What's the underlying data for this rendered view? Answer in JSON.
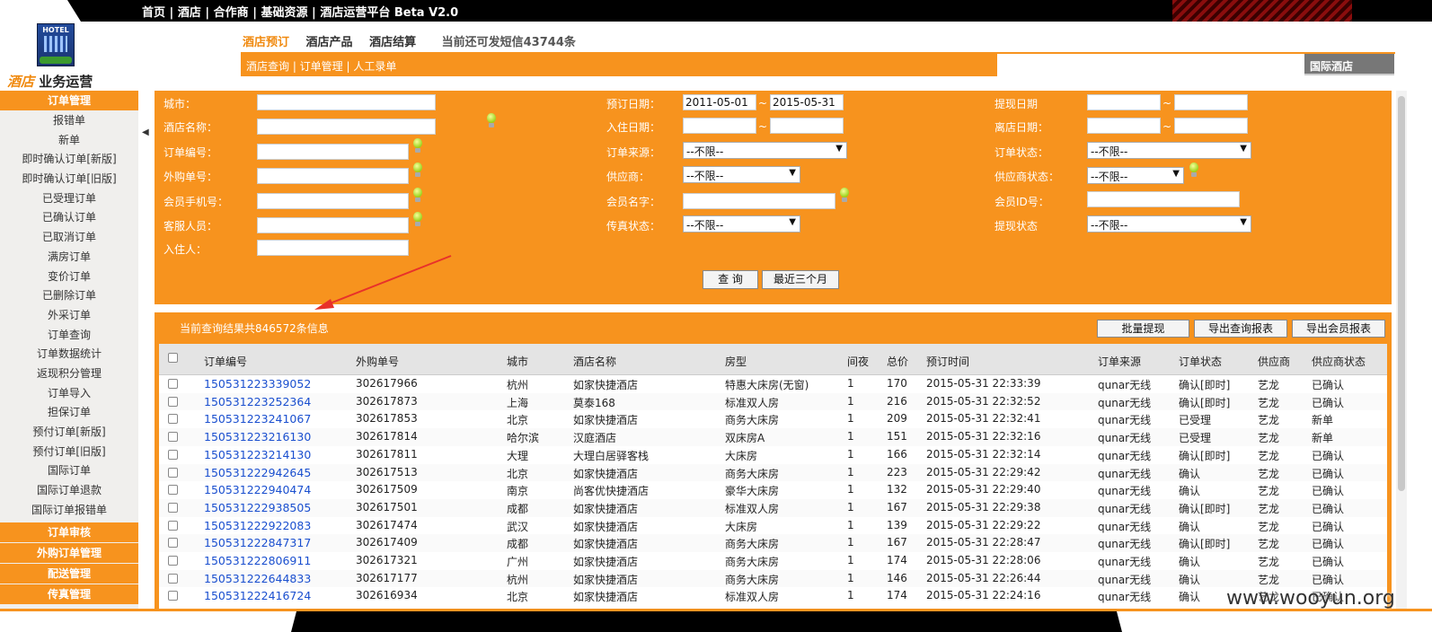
{
  "top_nav": [
    "首页",
    "酒店",
    "合作商",
    "基础资源",
    "酒店运营平台 Beta V2.0"
  ],
  "logo": {
    "badge": "HOTEL",
    "title_orange": "酒店",
    "title_black": "业务运营"
  },
  "sub_nav": {
    "tabs": [
      "酒店预订",
      "酒店产品",
      "酒店结算"
    ],
    "active": 0,
    "sms_text": "当前还可发短信43744条"
  },
  "breadcrumb": "酒店查询 | 订单管理 | 人工录单",
  "intl_tab": "国际酒店",
  "sidebar": {
    "section1": "订单管理",
    "items": [
      "报错单",
      "新单",
      "即时确认订单[新版]",
      "即时确认订单[旧版]",
      "已受理订单",
      "已确认订单",
      "已取消订单",
      "满房订单",
      "变价订单",
      "已删除订单",
      "外采订单",
      "订单查询",
      "订单数据统计",
      "返现积分管理",
      "订单导入",
      "担保订单",
      "预付订单[新版]",
      "预付订单[旧版]",
      "国际订单",
      "国际订单退款",
      "国际订单报错单"
    ],
    "bottom_sections": [
      "订单审核",
      "外购订单管理",
      "配送管理",
      "传真管理"
    ]
  },
  "search": {
    "labels": {
      "city": "城市：",
      "hotel_name": "酒店名称：",
      "order_no": "订单编号：",
      "ext_order_no": "外购单号：",
      "member_phone": "会员手机号：",
      "cs_staff": "客服人员：",
      "guest": "入住人：",
      "book_date": "预订日期：",
      "checkin_date": "入住日期：",
      "order_source": "订单来源：",
      "supplier": "供应商：",
      "member_name": "会员名字：",
      "fax_status": "传真状态：",
      "cashout_date": "提现日期",
      "checkout_date": "离店日期：",
      "order_status": "订单状态：",
      "supplier_status": "供应商状态：",
      "member_id": "会员ID号：",
      "cashout_status": "提现状态"
    },
    "book_date_from": "2011-05-01",
    "book_date_to": "2015-05-31",
    "tilde": "~",
    "select_default": "--不限--",
    "query_button": "查 询",
    "recent_button": "最近三个月"
  },
  "results": {
    "count_text": "当前查询结果共846572条信息",
    "buttons": [
      "批量提现",
      "导出查询报表",
      "导出会员报表"
    ],
    "headers": [
      "订单编号",
      "外购单号",
      "城市",
      "酒店名称",
      "房型",
      "间夜",
      "总价",
      "预订时间",
      "订单来源",
      "订单状态",
      "供应商",
      "供应商状态"
    ],
    "rows": [
      [
        "150531223339052",
        "302617966",
        "杭州",
        "如家快捷酒店",
        "特惠大床房(无窗)",
        "1",
        "170",
        "2015-05-31 22:33:39",
        "qunar无线",
        "确认[即时]",
        "艺龙",
        "已确认"
      ],
      [
        "150531223252364",
        "302617873",
        "上海",
        "莫泰168",
        "标准双人房",
        "1",
        "216",
        "2015-05-31 22:32:52",
        "qunar无线",
        "确认[即时]",
        "艺龙",
        "已确认"
      ],
      [
        "150531223241067",
        "302617853",
        "北京",
        "如家快捷酒店",
        "商务大床房",
        "1",
        "209",
        "2015-05-31 22:32:41",
        "qunar无线",
        "已受理",
        "艺龙",
        "新单"
      ],
      [
        "150531223216130",
        "302617814",
        "哈尔滨",
        "汉庭酒店",
        "双床房A",
        "1",
        "151",
        "2015-05-31 22:32:16",
        "qunar无线",
        "已受理",
        "艺龙",
        "新单"
      ],
      [
        "150531223214130",
        "302617811",
        "大理",
        "大理白居驿客栈",
        "大床房",
        "1",
        "166",
        "2015-05-31 22:32:14",
        "qunar无线",
        "确认[即时]",
        "艺龙",
        "已确认"
      ],
      [
        "150531222942645",
        "302617513",
        "北京",
        "如家快捷酒店",
        "商务大床房",
        "1",
        "223",
        "2015-05-31 22:29:42",
        "qunar无线",
        "确认",
        "艺龙",
        "已确认"
      ],
      [
        "150531222940474",
        "302617509",
        "南京",
        "尚客优快捷酒店",
        "豪华大床房",
        "1",
        "132",
        "2015-05-31 22:29:40",
        "qunar无线",
        "确认",
        "艺龙",
        "已确认"
      ],
      [
        "150531222938505",
        "302617501",
        "成都",
        "如家快捷酒店",
        "标准双人房",
        "1",
        "167",
        "2015-05-31 22:29:38",
        "qunar无线",
        "确认[即时]",
        "艺龙",
        "已确认"
      ],
      [
        "150531222922083",
        "302617474",
        "武汉",
        "如家快捷酒店",
        "大床房",
        "1",
        "139",
        "2015-05-31 22:29:22",
        "qunar无线",
        "确认",
        "艺龙",
        "已确认"
      ],
      [
        "150531222847317",
        "302617409",
        "成都",
        "如家快捷酒店",
        "商务大床房",
        "1",
        "167",
        "2015-05-31 22:28:47",
        "qunar无线",
        "确认[即时]",
        "艺龙",
        "已确认"
      ],
      [
        "150531222806911",
        "302617321",
        "广州",
        "如家快捷酒店",
        "商务大床房",
        "1",
        "174",
        "2015-05-31 22:28:06",
        "qunar无线",
        "确认",
        "艺龙",
        "已确认"
      ],
      [
        "150531222644833",
        "302617177",
        "杭州",
        "如家快捷酒店",
        "商务大床房",
        "1",
        "146",
        "2015-05-31 22:26:44",
        "qunar无线",
        "确认",
        "艺龙",
        "已确认"
      ],
      [
        "150531222416724",
        "302616934",
        "北京",
        "如家快捷酒店",
        "标准双人房",
        "1",
        "174",
        "2015-05-31 22:24:16",
        "qunar无线",
        "确认",
        "艺龙",
        "已确认"
      ]
    ]
  },
  "watermark": "www.wooyun.org",
  "colors": {
    "accent": "#f7931e",
    "link": "#1a4fcf"
  }
}
